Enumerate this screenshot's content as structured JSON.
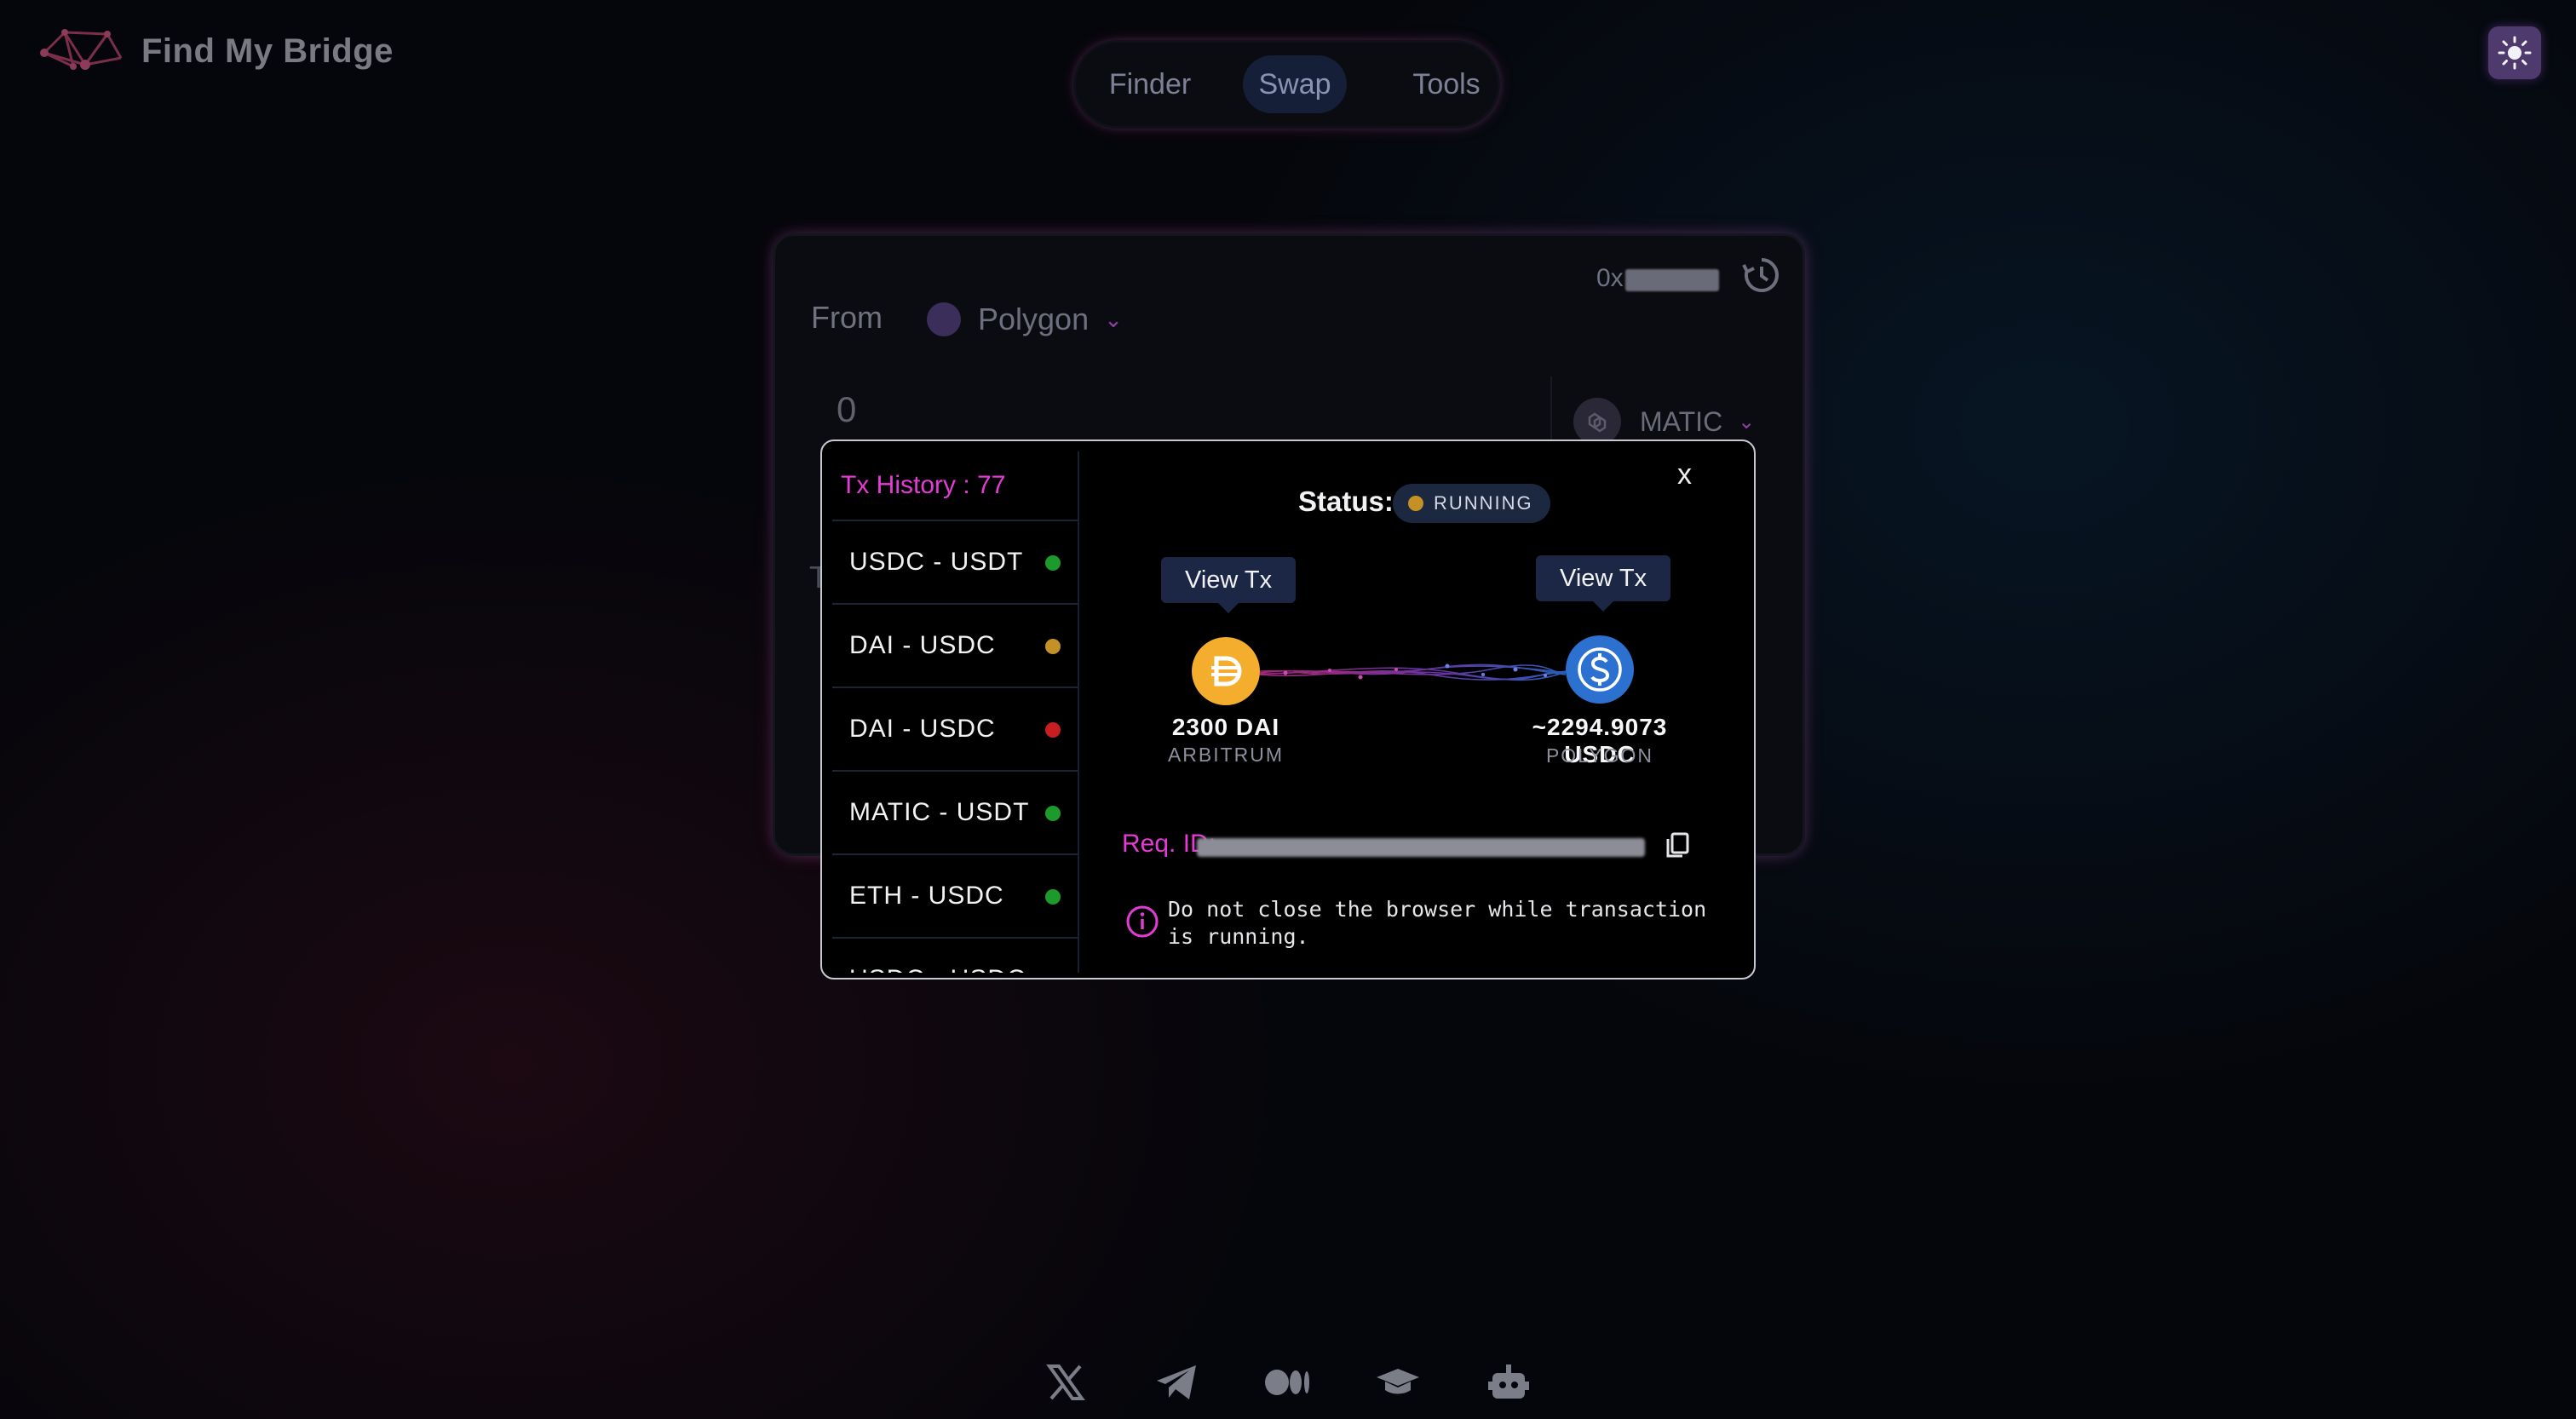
{
  "app": {
    "title": "Find My Bridge"
  },
  "nav": {
    "items": [
      "Finder",
      "Swap",
      "Tools"
    ],
    "active": "Swap"
  },
  "icons": {
    "theme": "sun-icon",
    "history": "history-icon",
    "copy": "copy-icon",
    "info": "info-icon"
  },
  "swap_card": {
    "wallet_prefix": "0x",
    "from_label": "From",
    "from_chain": "Polygon",
    "amount": "0",
    "from_token": "MATIC",
    "to_label_partial": "T"
  },
  "history": {
    "title": "Tx History : 77",
    "items": [
      {
        "pair": "USDC - USDT",
        "status": "success"
      },
      {
        "pair": "DAI - USDC",
        "status": "running"
      },
      {
        "pair": "DAI - USDC",
        "status": "failed"
      },
      {
        "pair": "MATIC - USDT",
        "status": "success"
      },
      {
        "pair": "ETH - USDC",
        "status": "success"
      },
      {
        "pair": "USDC - USDC",
        "status": "success"
      }
    ]
  },
  "tx_detail": {
    "close": "x",
    "status_label": "Status:",
    "status_value": "RUNNING",
    "view_tx_source": "View Tx",
    "view_tx_dest": "View Tx",
    "source_amount": "2300 DAI",
    "source_chain": "ARBITRUM",
    "dest_amount": "~2294.9073 USDC",
    "dest_chain": "POLYGON",
    "req_id_label": "Req. ID:",
    "warning": "Do not close the browser while transaction is running."
  },
  "footer_icons": [
    "x-twitter-icon",
    "telegram-icon",
    "medium-icon",
    "docs-icon",
    "bot-icon"
  ],
  "colors": {
    "accent_pink": "#e53bd6",
    "success": "#1c9a2c",
    "running": "#c39125",
    "failed": "#c81e22",
    "dai": "#f5ad2d",
    "usdc": "#2d71d0"
  }
}
